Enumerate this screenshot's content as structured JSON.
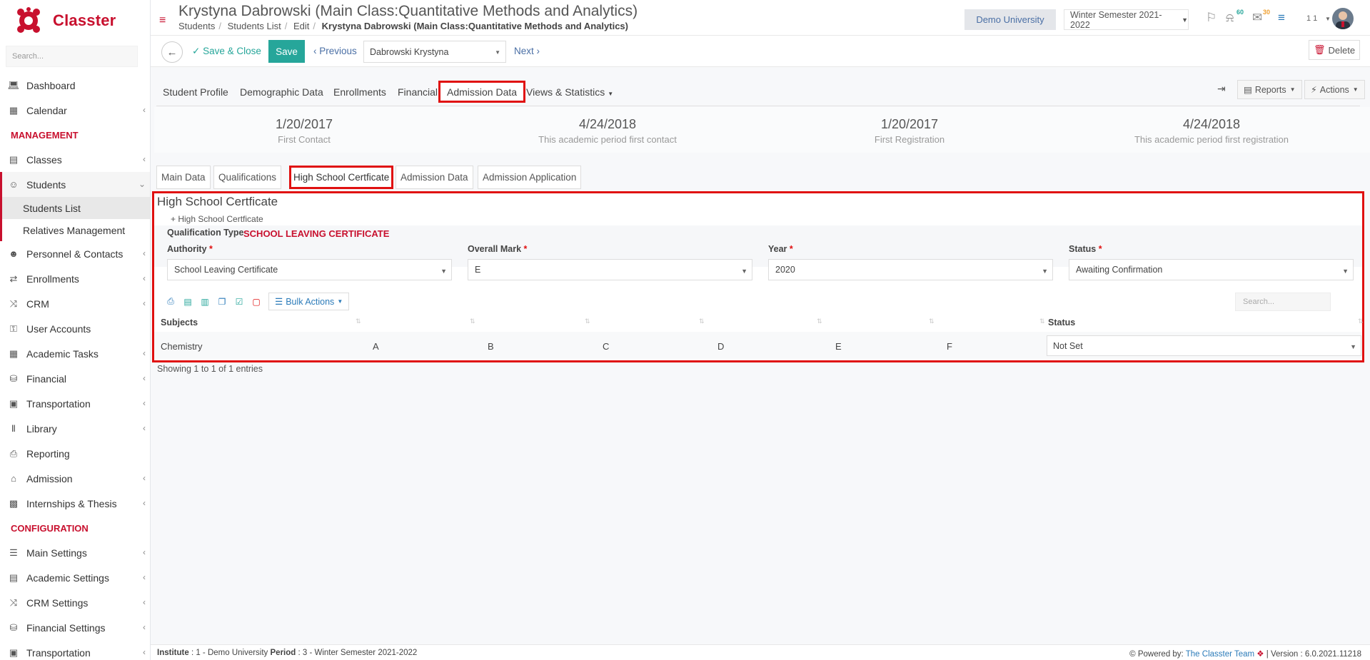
{
  "brand": {
    "name": "Classter",
    "color": "#c8102e"
  },
  "sidebar": {
    "search_placeholder": "Search...",
    "items": [
      {
        "label": "Dashboard",
        "icon": "laptop-icon"
      },
      {
        "label": "Calendar",
        "icon": "calendar-icon"
      }
    ],
    "section_management": "MANAGEMENT",
    "management_items": [
      {
        "label": "Classes",
        "icon": "classes-icon"
      },
      {
        "label": "Students",
        "icon": "users-icon"
      }
    ],
    "students_sub": [
      {
        "label": "Students List"
      },
      {
        "label": "Relatives Management"
      }
    ],
    "more_items": [
      {
        "label": "Personnel & Contacts",
        "icon": "person-icon"
      },
      {
        "label": "Enrollments",
        "icon": "arrows-icon"
      },
      {
        "label": "CRM",
        "icon": "shuffle-icon"
      },
      {
        "label": "User Accounts",
        "icon": "key-icon"
      },
      {
        "label": "Academic Tasks",
        "icon": "grid-icon"
      },
      {
        "label": "Financial",
        "icon": "coins-icon"
      },
      {
        "label": "Transportation",
        "icon": "bus-icon"
      },
      {
        "label": "Library",
        "icon": "books-icon"
      },
      {
        "label": "Reporting",
        "icon": "printer-icon"
      },
      {
        "label": "Admission",
        "icon": "institution-icon"
      },
      {
        "label": "Internships & Thesis",
        "icon": "cube-icon"
      }
    ],
    "section_configuration": "CONFIGURATION",
    "config_items": [
      {
        "label": "Main Settings",
        "icon": "sliders-icon"
      },
      {
        "label": "Academic Settings",
        "icon": "classes-icon"
      },
      {
        "label": "CRM Settings",
        "icon": "shuffle-icon"
      },
      {
        "label": "Financial Settings",
        "icon": "coins-icon"
      },
      {
        "label": "Transportation",
        "icon": "bus-icon"
      }
    ]
  },
  "header": {
    "title": "Krystyna Dabrowski (Main Class:Quantitative Methods and Analytics)",
    "breadcrumbs": [
      "Students",
      "Students List",
      "Edit"
    ],
    "breadcrumb_current": "Krystyna Dabrowski (Main Class:Quantitative Methods and Analytics)",
    "university": "Demo University",
    "semester": "Winter Semester 2021-2022",
    "notif_count": "60",
    "mail_count": "30",
    "user_text": "1 1"
  },
  "toolbar": {
    "save_close": "Save & Close",
    "save": "Save",
    "previous": "Previous",
    "student_select": "Dabrowski Krystyna",
    "next": "Next",
    "delete": "Delete"
  },
  "main_tabs": [
    "Student Profile",
    "Demographic Data",
    "Enrollments",
    "Financial",
    "Admission Data",
    "Views & Statistics"
  ],
  "right_tools": {
    "reports": "Reports",
    "actions": "Actions"
  },
  "stats": [
    {
      "value": "1/20/2017",
      "label": "First Contact"
    },
    {
      "value": "4/24/2018",
      "label": "This academic period first contact"
    },
    {
      "value": "1/20/2017",
      "label": "First Registration"
    },
    {
      "value": "4/24/2018",
      "label": "This academic period first registration"
    }
  ],
  "sub_tabs": [
    "Main Data",
    "Qualifications",
    "High School Certficate",
    "Admission Data",
    "Admission Application"
  ],
  "panel": {
    "title": "High School Certficate",
    "add_link": "High School Certficate",
    "qualification_type_label": "Qualification Type",
    "qualification_type_value": "SCHOOL LEAVING CERTIFICATE",
    "fields": [
      {
        "label": "Authority",
        "value": "School Leaving Certificate"
      },
      {
        "label": "Overall Mark",
        "value": "E"
      },
      {
        "label": "Year",
        "value": "2020"
      },
      {
        "label": "Status",
        "value": "Awaiting Confirmation"
      }
    ],
    "bulk_actions": "Bulk Actions",
    "search_placeholder": "Search...",
    "columns": [
      "Subjects",
      "",
      "",
      "",
      "",
      "",
      "",
      "Status"
    ],
    "row": {
      "subject": "Chemistry",
      "grades": [
        "A",
        "B",
        "C",
        "D",
        "E",
        "F"
      ],
      "status": "Not Set"
    }
  },
  "showing": "Showing 1 to 1 of 1 entries",
  "footer": {
    "institute_label": "Institute",
    "institute_value": ": 1 - Demo University",
    "period_label": "Period",
    "period_value": ": 3 - Winter Semester 2021-2022",
    "powered": "Powered by:",
    "team": "The Classter Team",
    "version": "| Version : 6.0.2021.11218"
  }
}
